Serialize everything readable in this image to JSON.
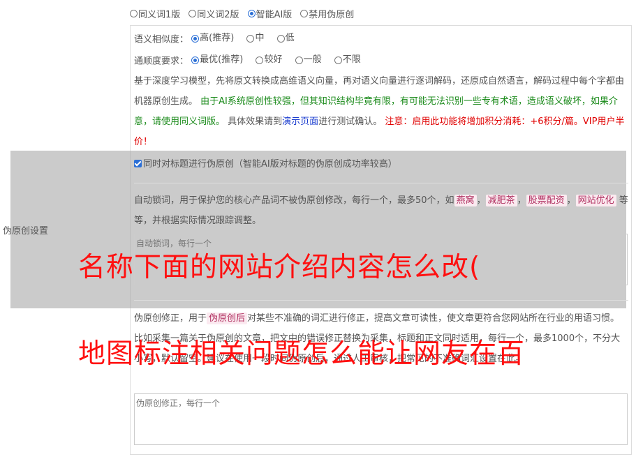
{
  "mode_options": [
    {
      "label": "同义词1版",
      "selected": false
    },
    {
      "label": "同义词2版",
      "selected": false
    },
    {
      "label": "智能AI版",
      "selected": true
    },
    {
      "label": "禁用伪原创",
      "selected": false
    }
  ],
  "similarity": {
    "label": "语义相似度：",
    "options": [
      {
        "label": "高(推荐)",
        "selected": true
      },
      {
        "label": "中",
        "selected": false
      },
      {
        "label": "低",
        "selected": false
      }
    ]
  },
  "fluency": {
    "label": "通顺度要求：",
    "options": [
      {
        "label": "最优(推荐)",
        "selected": true
      },
      {
        "label": "较好",
        "selected": false
      },
      {
        "label": "一般",
        "selected": false
      },
      {
        "label": "不限",
        "selected": false
      }
    ]
  },
  "description": {
    "part1": "基于深度学习模型，先将原文转换成高维语义向量，再对语义向量进行逐词解码，还原成自然语言，解码过程中每个字都由机器原创生成。",
    "part2": "由于AI系统原创性较强，但其知识结构毕竟有限，有可能无法识别一些专有术语，造成语义破坏，如果介意，请使用同义词版。",
    "part3": "具体效果请到",
    "link": "演示页面",
    "part4": "进行测试确认。",
    "warning": "注意：启用此功能将增加积分消耗：+6积分/篇。VIP用户半价！"
  },
  "title_checkbox": {
    "label": "同时对标题进行伪原创（智能AI版对标题的伪原创成功率较高）",
    "checked": true
  },
  "side_label": "伪原创设置",
  "lock_words": {
    "text1": "自动锁词，用于保护您的核心产品词不被伪原创修改，每行一个，最多50个，如",
    "tags": [
      "燕窝",
      "减肥茶",
      "股票配资",
      "网站优化"
    ],
    "sep": "，",
    "text2": "等等，并根据实际情况跟踪调整。",
    "placeholder": "自动锁词，每行一个"
  },
  "correction": {
    "text1": "伪原创修正，用于",
    "tag": "伪原创后",
    "text2": "对某些不准确的词汇进行修正，提高文章可读性，使文章更符合您网站所在行业的用语习惯。比如",
    "text3": "采集一篇关于伪原创的文章，把文中的错误修正替换为采集，标题和正文同时适用，每行一个，最多1000个，不分大小写，默认留空。建议在使用一段时间伪原创后，通过人工审核，把常见的不准确词汇设置在此。",
    "placeholder": "伪原创修正，每行一个"
  },
  "overlay": {
    "line1": "名称下面的网站介绍内容怎么改(",
    "line2": "地图标注相关问题怎么能让网友在百"
  },
  "colors": {
    "accent": "#2b6fd6",
    "overlay_text": "#ff1010",
    "warning": "#e00000",
    "note": "#1a8a1a"
  }
}
